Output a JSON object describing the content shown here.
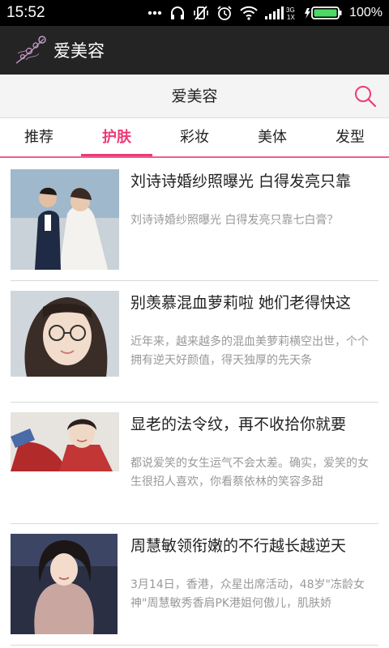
{
  "status_bar": {
    "time": "15:52",
    "network": "3G",
    "battery_percent": "100%"
  },
  "app": {
    "title": "爱美容"
  },
  "header": {
    "title": "爱美容",
    "search_icon": "search-icon"
  },
  "tabs": [
    {
      "label": "推荐",
      "active": false
    },
    {
      "label": "护肤",
      "active": true
    },
    {
      "label": "彩妆",
      "active": false
    },
    {
      "label": "美体",
      "active": false
    },
    {
      "label": "发型",
      "active": false
    }
  ],
  "articles": [
    {
      "title": "刘诗诗婚纱照曝光 白得发亮只靠",
      "summary": "刘诗诗婚纱照曝光 白得发亮只靠七白膏？"
    },
    {
      "title": "别羡慕混血萝莉啦 她们老得快这",
      "summary": "近年来，越来越多的混血美萝莉横空出世，个个拥有逆天好颜值，得天独厚的先天条"
    },
    {
      "title": "显老的法令纹，再不收拾你就要",
      "summary": "都说爱笑的女生运气不会太差。确实，爱笑的女生很招人喜欢，你看蔡依林的笑容多甜"
    },
    {
      "title": "周慧敏领衔嫩的不行越长越逆天",
      "summary": "3月14日，香港，众星出席活动，48岁\"冻龄女神\"周慧敏秀香肩PK港姐何傲儿，肌肤娇"
    }
  ],
  "colors": {
    "accent": "#ee3a76",
    "app_bar": "#242424",
    "status_bar": "#000000"
  }
}
